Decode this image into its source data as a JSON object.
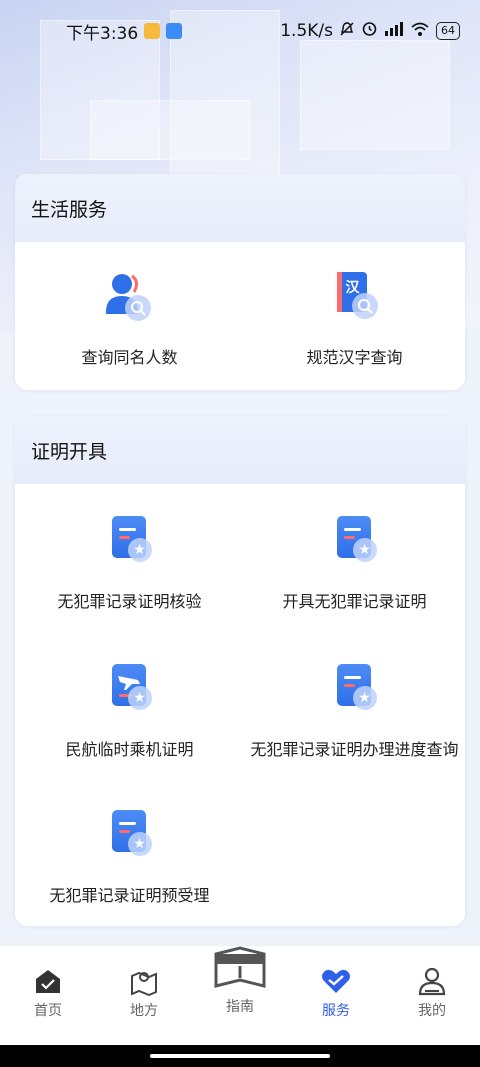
{
  "status_bar": {
    "time": "下午3:36",
    "net_speed": "1.5K/s",
    "battery": "64"
  },
  "sections": {
    "life": {
      "title": "生活服务",
      "items": [
        {
          "label": "查询同名人数",
          "icon": "user-search-icon"
        },
        {
          "label": "规范汉字查询",
          "icon": "dictionary-search-icon",
          "glyph": "汉"
        }
      ]
    },
    "cert": {
      "title": "证明开具",
      "items": [
        {
          "label": "无犯罪记录证明核验",
          "icon": "document-star-icon"
        },
        {
          "label": "开具无犯罪记录证明",
          "icon": "document-star-icon"
        },
        {
          "label": "民航临时乘机证明",
          "icon": "plane-document-icon"
        },
        {
          "label": "无犯罪记录证明办理进度查询",
          "icon": "document-star-icon"
        },
        {
          "label": "无犯罪记录证明预受理",
          "icon": "document-star-icon"
        }
      ]
    }
  },
  "tabbar": {
    "items": [
      {
        "label": "首页",
        "icon": "home-icon"
      },
      {
        "label": "地方",
        "icon": "map-icon"
      },
      {
        "label": "指南",
        "icon": "guide-book-icon"
      },
      {
        "label": "服务",
        "icon": "service-heart-icon",
        "active": true
      },
      {
        "label": "我的",
        "icon": "profile-icon"
      }
    ]
  },
  "colors": {
    "accent": "#2f5ee8",
    "icon_blue": "#2f6fe8",
    "icon_red": "#ff6b6b",
    "card_bg": "#ffffff",
    "page_bg": "#eef2fb"
  }
}
